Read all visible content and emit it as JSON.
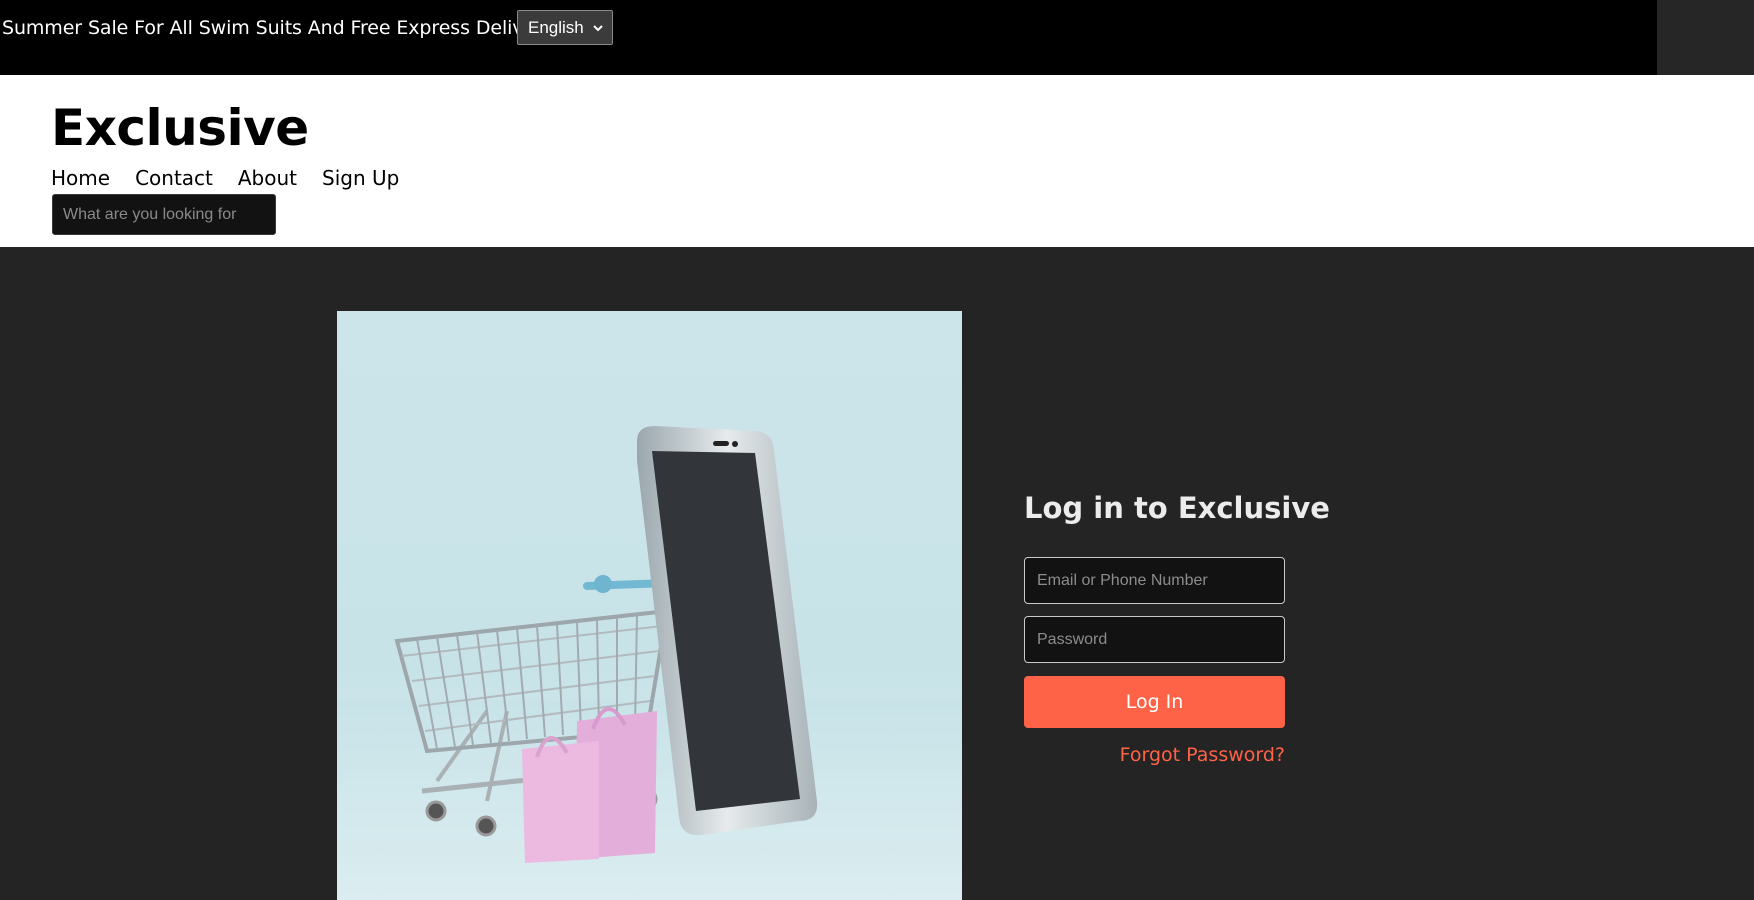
{
  "topbar": {
    "promo_text": "Summer Sale For All Swim Suits And Free Express Delivery",
    "language": "English"
  },
  "header": {
    "logo": "Exclusive",
    "nav": [
      "Home",
      "Contact",
      "About",
      "Sign Up"
    ],
    "search_placeholder": "What are you looking for"
  },
  "hero": {
    "illustration": "phone-and-shopping-cart-image"
  },
  "login": {
    "title": "Log in to Exclusive",
    "email_placeholder": "Email or Phone Number",
    "password_placeholder": "Password",
    "login_label": "Log In",
    "forgot_label": "Forgot Password?"
  },
  "colors": {
    "accent": "#ff6347",
    "topbar_bg": "#000000",
    "page_bg": "#242424",
    "header_bg": "#ffffff"
  }
}
